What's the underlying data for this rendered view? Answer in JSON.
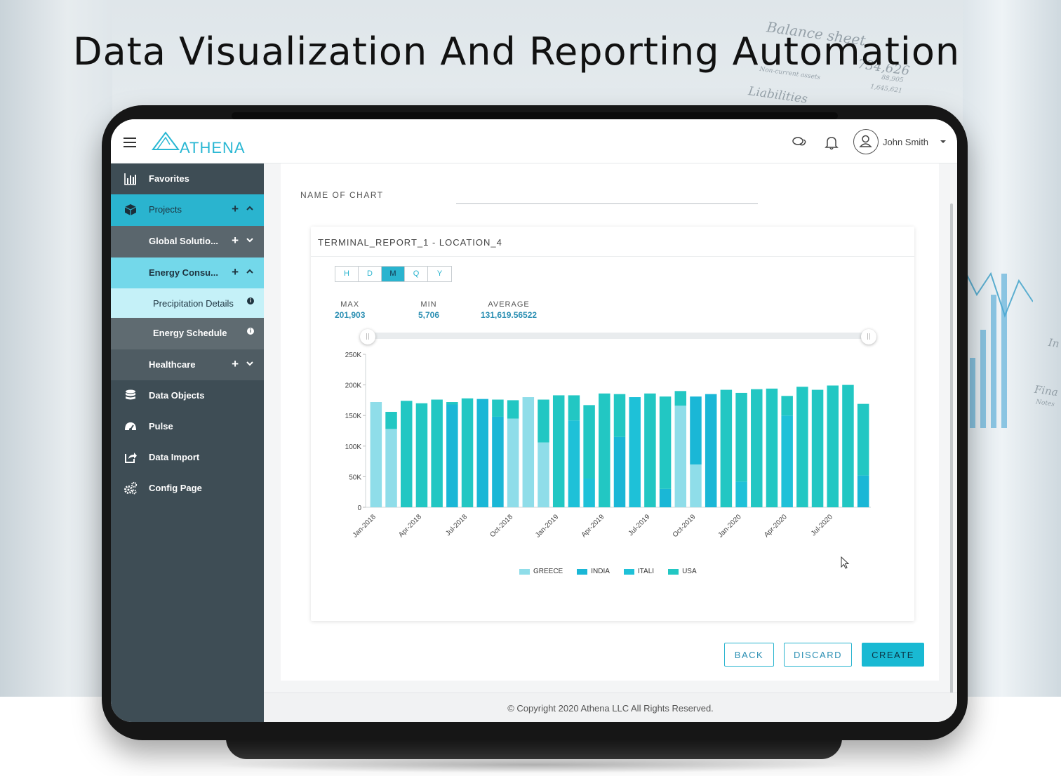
{
  "page": {
    "heading": "Data Visualization And Reporting Automation"
  },
  "topbar": {
    "logo_text": "ATHENA",
    "user_name": "John Smith"
  },
  "sidebar": {
    "items": [
      {
        "label": "Favorites",
        "icon": "bar-chart-icon"
      },
      {
        "label": "Projects",
        "icon": "cube-icon"
      },
      {
        "label": "Global Solutio...",
        "icon": ""
      },
      {
        "label": "Energy Consu...",
        "icon": ""
      },
      {
        "label": "Precipitation Details",
        "icon": "info-icon"
      },
      {
        "label": "Energy Schedule",
        "icon": "info-icon"
      },
      {
        "label": "Healthcare",
        "icon": ""
      },
      {
        "label": "Data Objects",
        "icon": "database-icon"
      },
      {
        "label": "Pulse",
        "icon": "gauge-icon"
      },
      {
        "label": "Data Import",
        "icon": "share-icon"
      },
      {
        "label": "Config Page",
        "icon": "gears-icon"
      }
    ]
  },
  "form": {
    "name_label": "NAME OF CHART",
    "name_value": ""
  },
  "card": {
    "title": "TERMINAL_REPORT_1 - LOCATION_4",
    "granularity": [
      "H",
      "D",
      "M",
      "Q",
      "Y"
    ],
    "granularity_selected": "M",
    "stats": [
      {
        "key": "MAX",
        "value": "201,903"
      },
      {
        "key": "MIN",
        "value": "5,706"
      },
      {
        "key": "AVERAGE",
        "value": "131,619.56522"
      }
    ],
    "range_handle_glyph": "||"
  },
  "chart_data": {
    "type": "bar",
    "stacked": true,
    "ylim": [
      0,
      250000
    ],
    "y_ticks": [
      "0",
      "50K",
      "100K",
      "150K",
      "200K",
      "250K"
    ],
    "x_tick_labels": [
      "Jan-2018",
      "Apr-2018",
      "Jul-2018",
      "Oct-2018",
      "Jan-2019",
      "Apr-2019",
      "Jul-2019",
      "Oct-2019",
      "Jan-2020",
      "Apr-2020",
      "Jul-2020"
    ],
    "categories": [
      "Jan-2018",
      "Feb-2018",
      "Mar-2018",
      "Apr-2018",
      "May-2018",
      "Jun-2018",
      "Jul-2018",
      "Aug-2018",
      "Sep-2018",
      "Oct-2018",
      "Nov-2018",
      "Dec-2018",
      "Jan-2019",
      "Feb-2019",
      "Mar-2019",
      "Apr-2019",
      "May-2019",
      "Jun-2019",
      "Jul-2019",
      "Aug-2019",
      "Sep-2019",
      "Oct-2019",
      "Nov-2019",
      "Dec-2019",
      "Jan-2020",
      "Feb-2020",
      "Mar-2020",
      "Apr-2020",
      "May-2020",
      "Jun-2020",
      "Jul-2020",
      "Aug-2020",
      "Sep-2020"
    ],
    "series": [
      {
        "name": "GREECE",
        "color": "#8fdde9",
        "values": [
          172000,
          128000,
          0,
          0,
          0,
          0,
          0,
          0,
          0,
          145000,
          180000,
          106000,
          0,
          0,
          0,
          0,
          0,
          0,
          0,
          0,
          166000,
          70000,
          0,
          0,
          0,
          0,
          0,
          0,
          0,
          0,
          0,
          0,
          0
        ]
      },
      {
        "name": "INDIA",
        "color": "#1ab7d6",
        "values": [
          0,
          0,
          0,
          0,
          0,
          168000,
          0,
          177000,
          148000,
          0,
          0,
          0,
          0,
          0,
          0,
          0,
          115000,
          0,
          0,
          30000,
          0,
          111000,
          185000,
          0,
          0,
          0,
          0,
          0,
          0,
          0,
          0,
          0,
          52000
        ]
      },
      {
        "name": "ITALI",
        "color": "#1ec1d8",
        "values": [
          0,
          0,
          0,
          0,
          0,
          0,
          0,
          0,
          0,
          0,
          0,
          0,
          0,
          142000,
          47000,
          0,
          0,
          180000,
          0,
          0,
          0,
          0,
          0,
          0,
          42000,
          0,
          0,
          150000,
          0,
          0,
          0,
          0,
          0
        ]
      },
      {
        "name": "USA",
        "color": "#22c7c3",
        "values": [
          0,
          28000,
          174000,
          170000,
          176000,
          4000,
          178000,
          0,
          28000,
          30000,
          0,
          70000,
          183000,
          41000,
          120000,
          186000,
          70000,
          0,
          186000,
          151000,
          24000,
          0,
          0,
          192000,
          145000,
          193000,
          194000,
          32000,
          197000,
          192000,
          199000,
          200000,
          117000
        ]
      }
    ]
  },
  "buttons": {
    "back": "BACK",
    "discard": "DISCARD",
    "create": "CREATE"
  },
  "footer": {
    "copyright": "© Copyright 2020 Athena LLC All Rights Reserved."
  },
  "background": {
    "texts": [
      "Balance sheet",
      "Liabilities",
      "Non-current assets",
      "1,645,621",
      "88,905",
      "734,626",
      "In",
      "Fina",
      "Notes"
    ]
  }
}
